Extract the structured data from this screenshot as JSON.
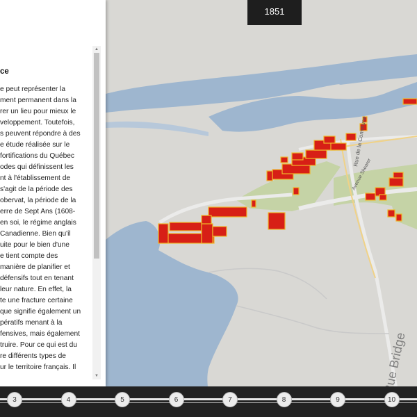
{
  "year": "1851",
  "panel": {
    "heading": "ce",
    "lines": [
      "e peut représenter la",
      "ment permanent dans la",
      "rer un lieu pour mieux le",
      "veloppement. Toutefois,",
      "s peuvent répondre à des",
      "e étude réalisée sur le",
      "fortifications du Québec",
      "odes qui définissent les",
      "nt à l'établissement de",
      "s'agit de la période des",
      "obervat, la période de la",
      "erre de Sept Ans (1608-",
      "en soi, le régime anglais",
      "Canadienne. Bien qu'il",
      "uite pour le bien d'une",
      "e tient compte des",
      "manière de planifier et",
      "défensifs tout en tenant",
      "leur nature. En effet, la",
      "te une fracture certaine",
      "que signifie également un",
      "pératifs menant à la",
      "fensives, mais également",
      "truire. Pour ce qui est du",
      "re différents types de",
      "ur le territoire français. Il"
    ]
  },
  "map": {
    "street_labels": [
      "Rue de la Commune",
      "Avenue Shearer",
      "Rue Bridge"
    ],
    "colors": {
      "water": "#9eb6cf",
      "land": "#d9d8d4",
      "park": "#c5d3a6",
      "building_roof": "#d71f16",
      "building_edge": "#f0b82a"
    }
  },
  "timeline": {
    "steps": [
      "3",
      "4",
      "5",
      "6",
      "7",
      "8",
      "9",
      "10"
    ]
  }
}
